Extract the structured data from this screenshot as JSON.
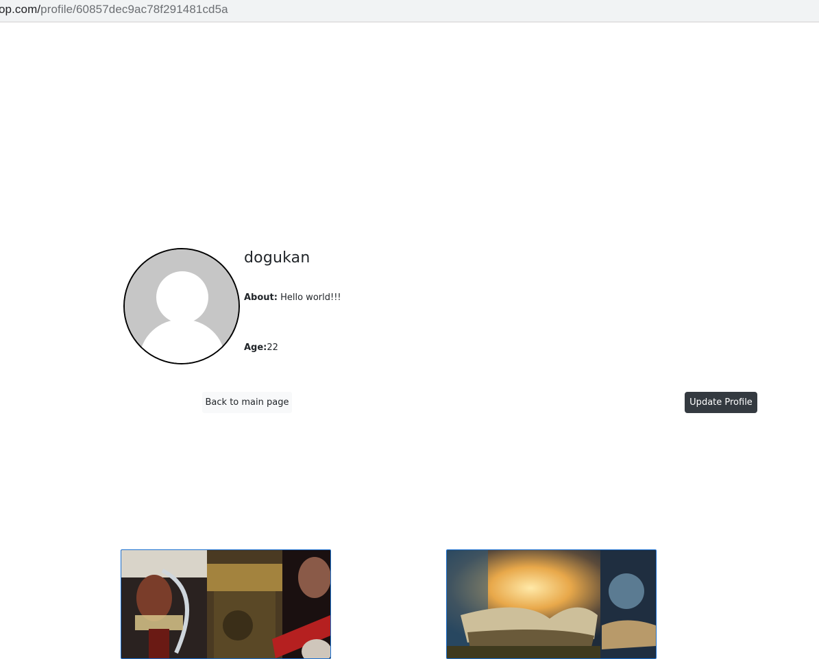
{
  "browser": {
    "url_domain": "op.com/",
    "url_path": "profile/60857dec9ac78f291481cd5a"
  },
  "profile": {
    "username": "dogukan",
    "about_label": "About:",
    "about_value": " Hello world!!!",
    "age_label": "Age:",
    "age_value": "22"
  },
  "actions": {
    "back_label": "Back to main page",
    "update_label": "Update Profile"
  },
  "colors": {
    "update_button_bg": "#343a40",
    "back_button_bg": "#f8f9fa",
    "card_border": "#1a6fd0",
    "avatar_bg": "#c6c6c6"
  },
  "cards": [
    {
      "image_icon": "horror-books-collage-image"
    },
    {
      "image_icon": "fantasy-open-book-image"
    }
  ]
}
